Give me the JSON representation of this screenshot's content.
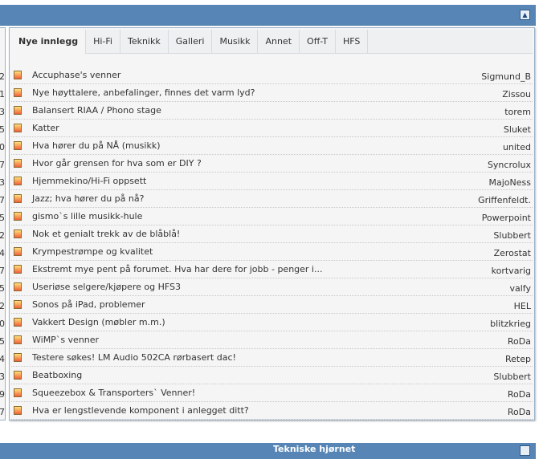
{
  "tabs": [
    "Nye innlegg",
    "Hi-Fi",
    "Teknikk",
    "Galleri",
    "Musikk",
    "Annet",
    "Off-T",
    "HFS"
  ],
  "left_counts": [
    "2",
    "1",
    "3",
    "5",
    "0",
    "7",
    "3",
    "7",
    "5",
    "2",
    "4",
    "7",
    "5",
    "2",
    "0",
    "5",
    "4",
    "3",
    "9",
    "7"
  ],
  "threads": [
    {
      "title": "Accuphase's venner",
      "user": "Sigmund_B"
    },
    {
      "title": "Nye høyttalere, anbefalinger, finnes det varm lyd?",
      "user": "Zissou"
    },
    {
      "title": "Balansert RIAA / Phono stage",
      "user": "torem"
    },
    {
      "title": "Katter",
      "user": "Sluket"
    },
    {
      "title": "Hva hører du på NÅ (musikk)",
      "user": "united"
    },
    {
      "title": "Hvor går grensen for hva som er DIY ?",
      "user": "Syncrolux"
    },
    {
      "title": "Hjemmekino/Hi-Fi oppsett",
      "user": "MajoNess"
    },
    {
      "title": "Jazz; hva hører du på nå?",
      "user": "Griffenfeldt."
    },
    {
      "title": "gismo`s lille musikk-hule",
      "user": "Powerpoint"
    },
    {
      "title": "Nok et genialt trekk av de blåblå!",
      "user": "Slubbert"
    },
    {
      "title": "Krympestrømpe og kvalitet",
      "user": "Zerostat"
    },
    {
      "title": "Ekstremt mye pent på forumet. Hva har dere for jobb - penger i...",
      "user": "kortvarig"
    },
    {
      "title": "Useriøse selgere/kjøpere og HFS3",
      "user": "valfy"
    },
    {
      "title": "Sonos på iPad, problemer",
      "user": "HEL"
    },
    {
      "title": "Vakkert Design (møbler m.m.)",
      "user": "blitzkrieg"
    },
    {
      "title": "WiMP`s venner",
      "user": "RoDa"
    },
    {
      "title": "Testere søkes! LM Audio 502CA rørbasert dac!",
      "user": "Retep"
    },
    {
      "title": "Beatboxing",
      "user": "Slubbert"
    },
    {
      "title": "Squeezebox & Transporters` Venner!",
      "user": "RoDa"
    },
    {
      "title": "Hva er lengstlevende komponent i anlegget ditt?",
      "user": "RoDa"
    }
  ],
  "next_section_title": "Tekniske hjørnet"
}
